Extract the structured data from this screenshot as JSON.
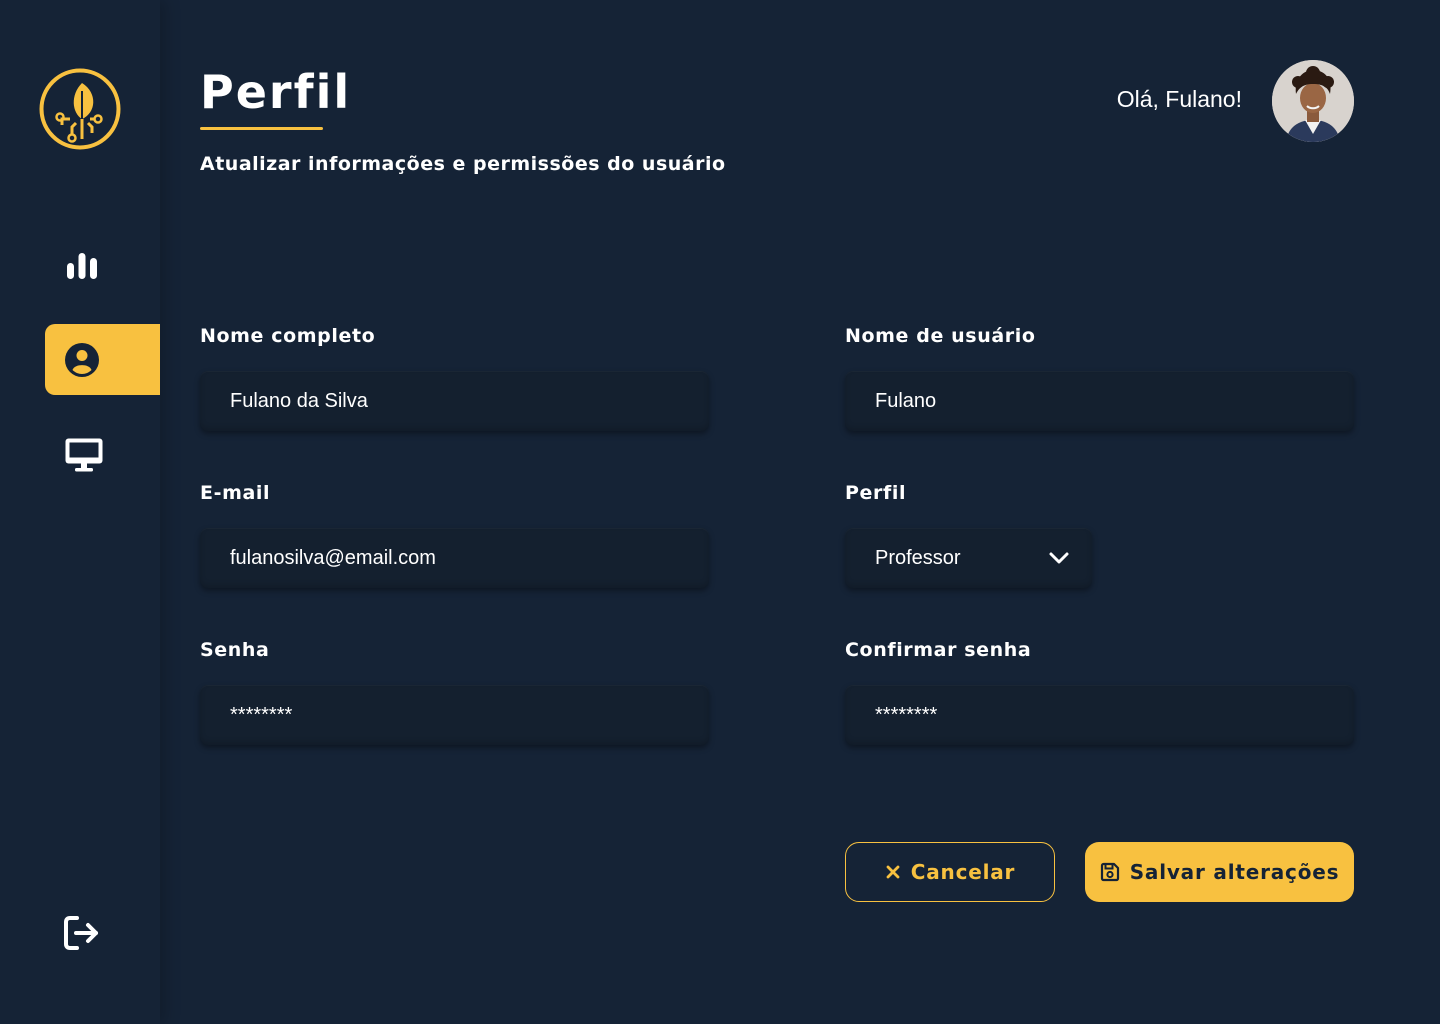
{
  "header": {
    "title": "Perfil",
    "subtitle": "Atualizar informações e permissões do usuário",
    "greeting": "Olá, Fulano!"
  },
  "sidebar": {
    "items": [
      {
        "icon": "bar-chart-icon",
        "active": false
      },
      {
        "icon": "user-circle-icon",
        "active": true
      },
      {
        "icon": "monitor-icon",
        "active": false
      }
    ],
    "logout_icon": "logout-icon"
  },
  "form": {
    "full_name": {
      "label": "Nome completo",
      "value": "Fulano da Silva"
    },
    "username": {
      "label": "Nome de usuário",
      "value": "Fulano"
    },
    "email": {
      "label": "E-mail",
      "value": "fulanosilva@email.com"
    },
    "profile": {
      "label": "Perfil",
      "value": "Professor"
    },
    "password": {
      "label": "Senha",
      "value": "********"
    },
    "confirm_password": {
      "label": "Confirmar senha",
      "value": "********"
    }
  },
  "actions": {
    "cancel_label": "Cancelar",
    "save_label": "Salvar alterações"
  },
  "colors": {
    "background": "#152336",
    "accent": "#F8C140",
    "text": "#ffffff"
  }
}
